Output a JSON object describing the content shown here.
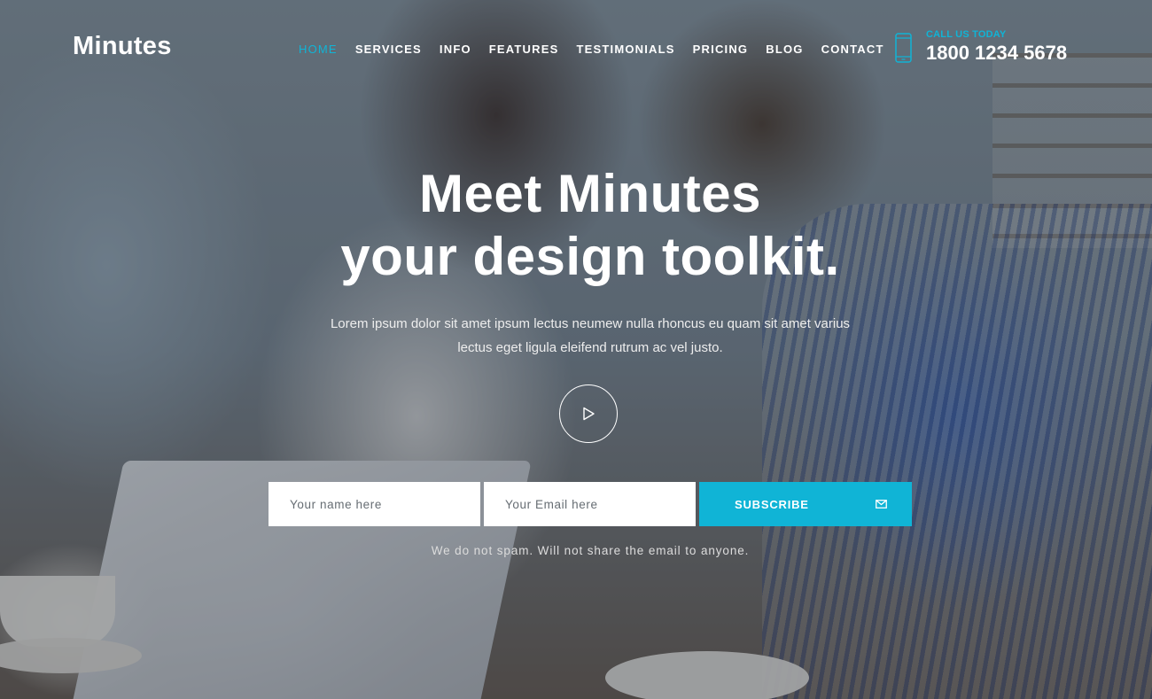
{
  "brand": {
    "logo": "Minutes"
  },
  "nav": {
    "items": [
      {
        "label": "HOME",
        "active": true
      },
      {
        "label": "SERVICES",
        "active": false
      },
      {
        "label": "INFO",
        "active": false
      },
      {
        "label": "FEATURES",
        "active": false
      },
      {
        "label": "TESTIMONIALS",
        "active": false
      },
      {
        "label": "PRICING",
        "active": false
      },
      {
        "label": "BLOG",
        "active": false
      },
      {
        "label": "CONTACT",
        "active": false
      }
    ]
  },
  "contact": {
    "label": "CALL US TODAY",
    "phone": "1800 1234 5678",
    "icon": "mobile-phone-icon"
  },
  "hero": {
    "headline_line1": "Meet Minutes",
    "headline_line2": "your design toolkit.",
    "subtext": "Lorem ipsum dolor sit amet ipsum lectus neumew nulla rhoncus eu quam sit amet varius lectus eget ligula eleifend rutrum ac vel justo.",
    "play_icon": "play-icon"
  },
  "form": {
    "name_placeholder": "Your name here",
    "name_value": "",
    "email_placeholder": "Your Email here",
    "email_value": "",
    "subscribe_label": "SUBSCRIBE",
    "subscribe_icon": "envelope-icon",
    "note": "We do not spam. Will not share the email to anyone."
  },
  "colors": {
    "accent": "#10b4d6",
    "text": "#ffffff"
  }
}
